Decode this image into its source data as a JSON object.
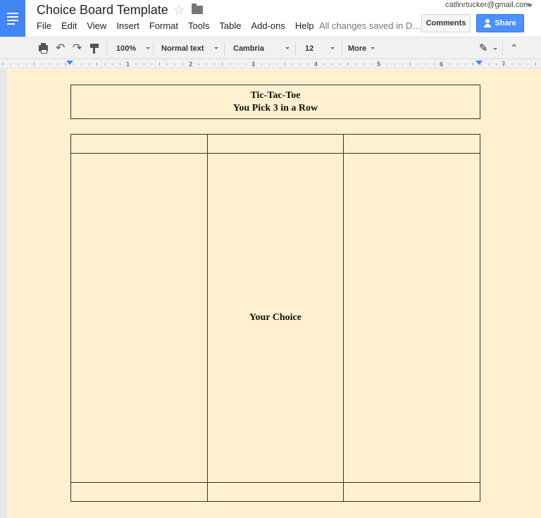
{
  "app": {
    "doc_title": "Choice Board Template",
    "account_email": "catlinrtucker@gmail.com",
    "save_status": "All changes saved in D…",
    "comments_label": "Comments",
    "share_label": "Share"
  },
  "menu": {
    "items": [
      "File",
      "Edit",
      "View",
      "Insert",
      "Format",
      "Tools",
      "Table",
      "Add-ons",
      "Help"
    ]
  },
  "toolbar": {
    "zoom": "100%",
    "style": "Normal text",
    "font": "Cambria",
    "font_size": "12",
    "more_label": "More"
  },
  "ruler": {
    "numbers": [
      "1",
      "2",
      "3",
      "4",
      "5",
      "6",
      "7"
    ]
  },
  "document": {
    "background_color": "#fff1cf",
    "title_line1": "Tic-Tac-Toe",
    "title_line2": "You Pick 3 in a Row",
    "board": [
      [
        "",
        "",
        ""
      ],
      [
        "",
        "Your Choice",
        ""
      ],
      [
        "",
        "",
        ""
      ]
    ]
  },
  "icons": {
    "logo": "docs-menu-icon",
    "star": "star-icon",
    "folder": "folder-icon",
    "print": "print-icon",
    "undo": "undo-icon",
    "redo": "redo-icon",
    "paint_format": "paint-format-icon",
    "edit_mode": "pencil-icon",
    "collapse": "collapse-icon"
  },
  "colors": {
    "brand_blue": "#4285f4",
    "share_blue": "#4d90fe"
  }
}
